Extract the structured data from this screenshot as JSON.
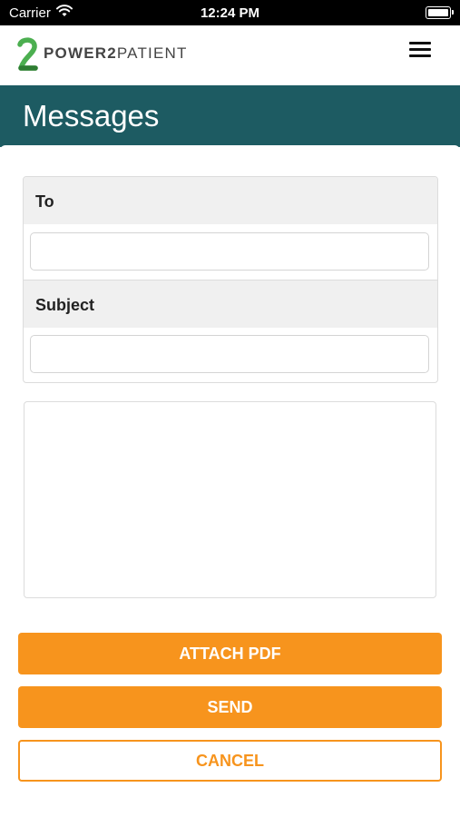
{
  "status_bar": {
    "carrier": "Carrier",
    "time": "12:24 PM",
    "icons": [
      "wifi-icon",
      "battery-icon"
    ]
  },
  "header": {
    "logo_text_bold": "POWER2",
    "logo_text_regular": "PATIENT",
    "menu_icon": "hamburger-menu-icon"
  },
  "title": "Messages",
  "form": {
    "to_label": "To",
    "to_value": "",
    "subject_label": "Subject",
    "subject_value": "",
    "message_value": ""
  },
  "buttons": {
    "attach": "ATTACH PDF",
    "send": "SEND",
    "cancel": "CANCEL"
  },
  "colors": {
    "title_band": "#1d5b62",
    "accent_orange": "#f7941d",
    "logo_green": "#4caf50"
  }
}
